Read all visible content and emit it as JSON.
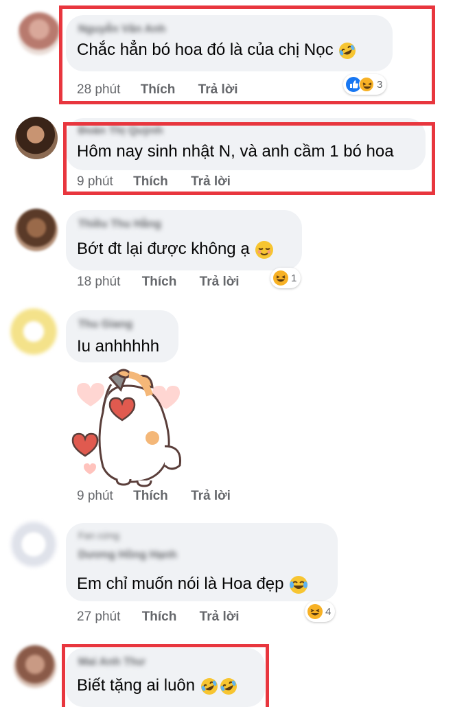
{
  "comments": [
    {
      "author": "Nguyễn Vân Anh",
      "text": "Chắc hẳn bó hoa đó là của chị Nọc",
      "emoji": "rofl-emoji",
      "time": "28 phút",
      "like": "Thích",
      "reply": "Trả lời",
      "reactions": {
        "icons": [
          "like-icon",
          "haha-icon"
        ],
        "count": "3"
      }
    },
    {
      "author": "Đoàn Thị Quỳnh",
      "text": "Hôm nay sinh nhật N, và anh cầm 1 bó hoa",
      "time": "9 phút",
      "like": "Thích",
      "reply": "Trả lời"
    },
    {
      "author": "Thiều Thu Hằng",
      "text": "Bớt đt lại được không ạ",
      "emoji": "relieved-emoji",
      "time": "18 phút",
      "like": "Thích",
      "reply": "Trả lời",
      "reactions": {
        "icons": [
          "haha-icon"
        ],
        "count": "1"
      }
    },
    {
      "author": "Thu Giang",
      "text": "Iu anhhhhh",
      "sticker": "cat-hearts-sticker",
      "time": "9 phút",
      "like": "Thích",
      "reply": "Trả lời"
    },
    {
      "badge": "Fan cứng",
      "author": "Dương Hồng Hạnh",
      "text": "Em chỉ muốn nói là Hoa đẹp",
      "emoji": "joy-emoji",
      "time": "27 phút",
      "like": "Thích",
      "reply": "Trả lời",
      "reactions": {
        "icons": [
          "haha-icon"
        ],
        "count": "4"
      }
    },
    {
      "author": "Mai Anh Thư",
      "text": "Biết tặng ai luôn",
      "emoji": "rofl-emoji",
      "emoji2": "rofl-emoji"
    }
  ],
  "colors": {
    "highlight": "#e8363e",
    "bubble": "#f0f2f5",
    "meta": "#65676b",
    "like_blue": "#1877f2",
    "haha_yellow": "#f7b125"
  }
}
